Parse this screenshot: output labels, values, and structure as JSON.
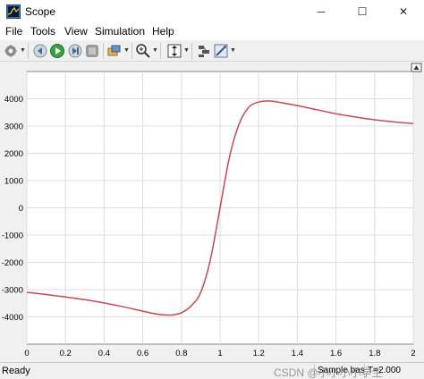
{
  "window": {
    "title": "Scope",
    "minimize_glyph": "─",
    "maximize_glyph": "☐",
    "close_glyph": "✕"
  },
  "menu": {
    "items": [
      "File",
      "Tools",
      "View",
      "Simulation",
      "Help"
    ]
  },
  "toolbar": {
    "icons": [
      "settings-icon",
      "back-icon",
      "run-icon",
      "step-forward-icon",
      "stop-icon",
      "highlight-icon",
      "zoom-icon",
      "autoscale-icon",
      "triggers-icon",
      "measure-icon"
    ]
  },
  "status": {
    "ready": "Ready",
    "sample_mode": "Sample based",
    "time": "T=2.000"
  },
  "watermark": "CSDN @小小小小学生",
  "colors": {
    "line": "#c8494e",
    "plot_bg": "#ffffff",
    "grid": "#dcdcdc"
  },
  "chart_data": {
    "type": "line",
    "title": "",
    "xlabel": "",
    "ylabel": "",
    "xlim": [
      0,
      2
    ],
    "ylim": [
      -5000,
      5000
    ],
    "xticks": [
      "0",
      "0.2",
      "0.4",
      "0.6",
      "0.8",
      "1",
      "1.2",
      "1.4",
      "1.6",
      "1.8",
      "2"
    ],
    "yticks": [
      "4000",
      "3000",
      "2000",
      "1000",
      "0",
      "-1000",
      "-2000",
      "-3000",
      "-4000"
    ],
    "grid": true,
    "series": [
      {
        "x": [
          0,
          0.1,
          0.2,
          0.3,
          0.4,
          0.5,
          0.6,
          0.65,
          0.7,
          0.75,
          0.8,
          0.85,
          0.9,
          0.95,
          1.0,
          1.05,
          1.1,
          1.15,
          1.2,
          1.25,
          1.3,
          1.4,
          1.5,
          1.6,
          1.7,
          1.8,
          1.9,
          2.0
        ],
        "values": [
          -3100,
          -3180,
          -3270,
          -3370,
          -3490,
          -3630,
          -3790,
          -3870,
          -3920,
          -3930,
          -3850,
          -3600,
          -3100,
          -1900,
          0,
          1900,
          3100,
          3700,
          3880,
          3920,
          3880,
          3750,
          3600,
          3450,
          3330,
          3230,
          3150,
          3090
        ]
      }
    ]
  }
}
